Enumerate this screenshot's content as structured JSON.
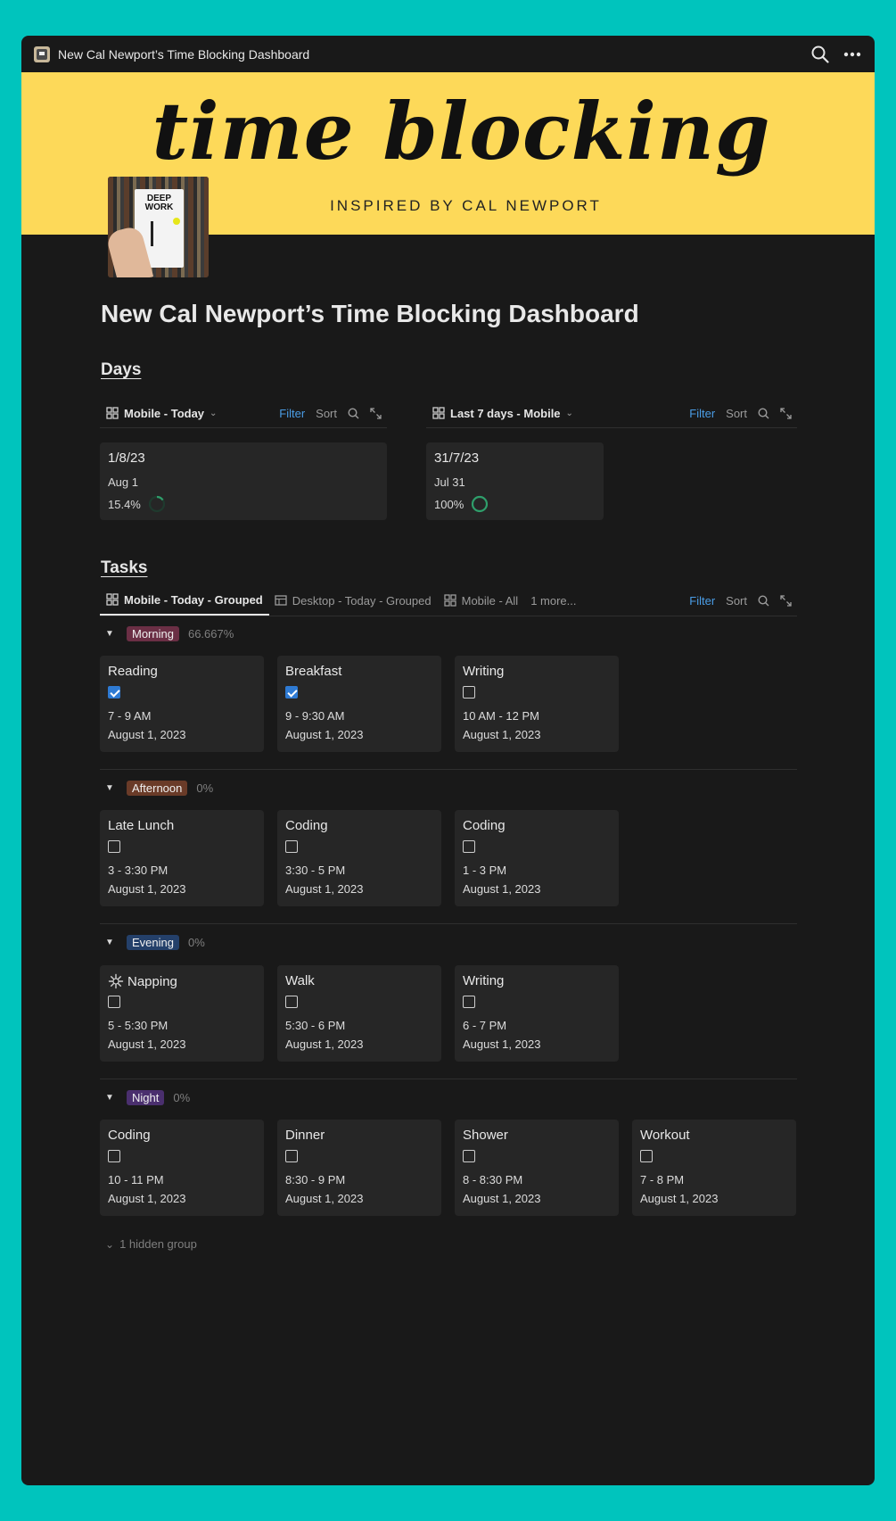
{
  "window": {
    "title": "New Cal Newport’s Time Blocking Dashboard"
  },
  "banner": {
    "script_title": "time blocking",
    "tagline": "INSPIRED BY CAL NEWPORT",
    "cover_title": "DEEP WORK"
  },
  "page": {
    "title": "New Cal Newport’s Time Blocking Dashboard"
  },
  "days": {
    "heading": "Days",
    "left_bar": {
      "view": "Mobile - Today",
      "filter": "Filter",
      "sort": "Sort"
    },
    "right_bar": {
      "view": "Last 7 days - Mobile",
      "filter": "Filter",
      "sort": "Sort"
    },
    "cards": [
      {
        "title": "1/8/23",
        "date": "Aug 1",
        "progress_text": "15.4%",
        "progress": 0.154
      },
      {
        "title": "31/7/23",
        "date": "Jul 31",
        "progress_text": "100%",
        "progress": 1.0
      }
    ]
  },
  "tasks": {
    "heading": "Tasks",
    "tabs": [
      {
        "label": "Mobile - Today - Grouped"
      },
      {
        "label": "Desktop - Today - Grouped"
      },
      {
        "label": "Mobile - All"
      },
      {
        "label": "1 more..."
      }
    ],
    "filter": "Filter",
    "sort": "Sort",
    "groups": [
      {
        "name": "Morning",
        "pct": "66.667%",
        "color": "#6b2f45",
        "items": [
          {
            "name": "Reading",
            "checked": true,
            "time": "7 - 9 AM",
            "date": "August 1, 2023"
          },
          {
            "name": "Breakfast",
            "checked": true,
            "time": "9 - 9:30 AM",
            "date": "August 1, 2023"
          },
          {
            "name": "Writing",
            "checked": false,
            "time": "10 AM - 12 PM",
            "date": "August 1, 2023"
          }
        ]
      },
      {
        "name": "Afternoon",
        "pct": "0%",
        "color": "#6a3b28",
        "items": [
          {
            "name": "Late Lunch",
            "checked": false,
            "time": "3 - 3:30 PM",
            "date": "August 1, 2023"
          },
          {
            "name": "Coding",
            "checked": false,
            "time": "3:30 - 5 PM",
            "date": "August 1, 2023"
          },
          {
            "name": "Coding",
            "checked": false,
            "time": "1 - 3 PM",
            "date": "August 1, 2023"
          }
        ]
      },
      {
        "name": "Evening",
        "pct": "0%",
        "color": "#24406a",
        "items": [
          {
            "name": "Napping",
            "checked": false,
            "time": "5 - 5:30 PM",
            "date": "August 1, 2023",
            "icon": "sparkle-icon"
          },
          {
            "name": "Walk",
            "checked": false,
            "time": "5:30 - 6 PM",
            "date": "August 1, 2023"
          },
          {
            "name": "Writing",
            "checked": false,
            "time": "6 - 7 PM",
            "date": "August 1, 2023"
          }
        ]
      },
      {
        "name": "Night",
        "pct": "0%",
        "color": "#4a2f6e",
        "items": [
          {
            "name": "Coding",
            "checked": false,
            "time": "10 - 11 PM",
            "date": "August 1, 2023"
          },
          {
            "name": "Dinner",
            "checked": false,
            "time": "8:30 - 9 PM",
            "date": "August 1, 2023"
          },
          {
            "name": "Shower",
            "checked": false,
            "time": "8 - 8:30 PM",
            "date": "August 1, 2023"
          },
          {
            "name": "Workout",
            "checked": false,
            "time": "7 - 8 PM",
            "date": "August 1, 2023"
          }
        ]
      }
    ],
    "hidden_groups": "1 hidden group"
  },
  "colors": {
    "accent_blue": "#4a9de6",
    "checkbox_blue": "#2e7ad3",
    "progress_green": "#2f9e6b",
    "banner_yellow": "#fdd959"
  }
}
